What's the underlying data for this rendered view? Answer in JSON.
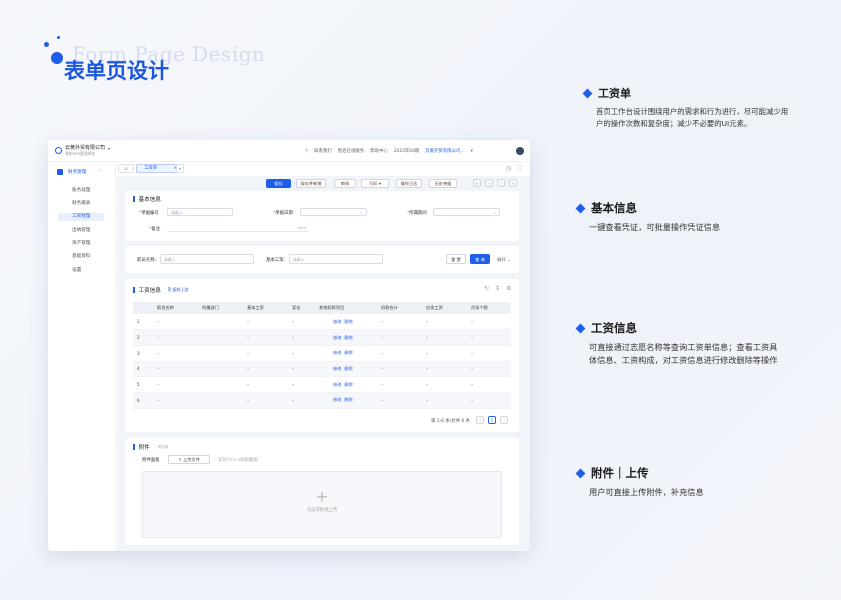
{
  "header": {
    "subtitle_en": "Form Page Design",
    "title_cn": "表单页设计"
  },
  "descriptions": [
    {
      "title": "工资单",
      "text": "首页工作台设计围绕用户的需求和行为进行，尽可能减少用户的操作次数和复杂度；减少不必要的UI元素。"
    },
    {
      "title": "基本信息",
      "text": "一键查看凭证，可批量操作凭证信息"
    },
    {
      "title": "工资信息",
      "text": "可直接通过志愿名称等查询工资单信息；查看工资具体信息、工资构成，对工资信息进行修改删除等操作"
    },
    {
      "title": "附件｜上传",
      "text": "用户可直接上传附件，补充信息"
    }
  ],
  "app": {
    "company": "云黄外贸有限公司",
    "company_sub": "我的ERP管理系统",
    "topnav": [
      "联系我们",
      "售后在线服务",
      "帮助中心",
      "2023年04期",
      "云黄外贸有限公司..."
    ],
    "sidebar": {
      "head": "财务管理",
      "items": [
        "账务处理",
        "财务报表",
        "工资管理",
        "出纳管理",
        "资产管理",
        "基础资料",
        "设置"
      ],
      "active_index": 2
    },
    "tabs": {
      "current": "工资单"
    },
    "toolbar": {
      "save": "保存",
      "save_new": "保存并新增",
      "audit": "审核",
      "print": "打印",
      "log": "操作日志",
      "history": "历史单据"
    },
    "basic": {
      "title": "基本信息",
      "fields": [
        {
          "label": "单据编号",
          "placeholder": "请输入..."
        },
        {
          "label": "单据日期",
          "placeholder": ""
        },
        {
          "label": "所属期间",
          "placeholder": ""
        },
        {
          "label": "备注",
          "placeholder": ""
        }
      ],
      "remark_count": "0/50"
    },
    "search": {
      "name_label": "职员名称:",
      "name_placeholder": "请输入",
      "salary_label": "基本工资:",
      "salary_placeholder": "请输入",
      "reset": "重 置",
      "query": "查 询",
      "expand": "展开"
    },
    "salary": {
      "title": "工资信息",
      "batch_upload": "复制上游",
      "columns": [
        "",
        "职员名称",
        "所属部门",
        "基本工资",
        "奖金",
        "其他扣款项目",
        "扣款合计",
        "应发工资",
        "代扣个税"
      ],
      "rows": [
        {
          "no": "1",
          "cells": [
            "–",
            "",
            "–",
            "–",
            "",
            "–",
            "–",
            "–"
          ]
        },
        {
          "no": "2",
          "cells": [
            "–",
            "",
            "–",
            "–",
            "",
            "–",
            "–",
            "–"
          ]
        },
        {
          "no": "3",
          "cells": [
            "–",
            "",
            "–",
            "–",
            "",
            "–",
            "–",
            "–"
          ]
        },
        {
          "no": "4",
          "cells": [
            "–",
            "",
            "–",
            "–",
            "",
            "–",
            "–",
            "–"
          ]
        },
        {
          "no": "5",
          "cells": [
            "–",
            "",
            "–",
            "–",
            "",
            "–",
            "–",
            "–"
          ]
        },
        {
          "no": "6",
          "cells": [
            "–",
            "",
            "–",
            "–",
            "",
            "–",
            "–",
            "–"
          ]
        }
      ],
      "edit_label": "修改",
      "delete_label": "删除",
      "pagination": "第 1-6 条/总共 6 条",
      "current_page": "1"
    },
    "attachment": {
      "title": "附件",
      "title_note": "附件数",
      "panel_label": "附件面板",
      "upload_button": "上传文件",
      "upload_hint": "支持ctrl+v粘贴截图",
      "drop_text": "点击或拖拽上传"
    }
  },
  "colors": {
    "accent": "#1f5ee8"
  }
}
